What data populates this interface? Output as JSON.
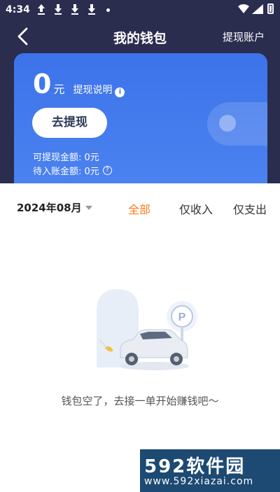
{
  "status_bar": {
    "time": "4:34",
    "notification_icons": [
      "upload-icon",
      "download-icon",
      "download-icon",
      "download-icon"
    ]
  },
  "navbar": {
    "title": "我的钱包",
    "right_link": "提现账户"
  },
  "wallet_card": {
    "amount": "0",
    "unit": "元",
    "explain_label": "提现说明",
    "withdraw_button": "去提现",
    "withdrawable_label": "可提现金额: 0元",
    "pending_label": "待入账金额: 0元"
  },
  "filter": {
    "date": "2024年08月",
    "tabs": [
      {
        "label": "全部",
        "active": true
      },
      {
        "label": "仅收入",
        "active": false
      },
      {
        "label": "仅支出",
        "active": false
      }
    ]
  },
  "empty_state": {
    "message": "钱包空了，去接一单开始赚钱吧～",
    "parking_sign": "P"
  },
  "watermark": {
    "logo": "592软件园",
    "url": "www.592xiazai.com"
  },
  "colors": {
    "header_bg": "#2b2d4f",
    "card_blue": "#3c73ea",
    "active_tab": "#ff7a1a"
  }
}
